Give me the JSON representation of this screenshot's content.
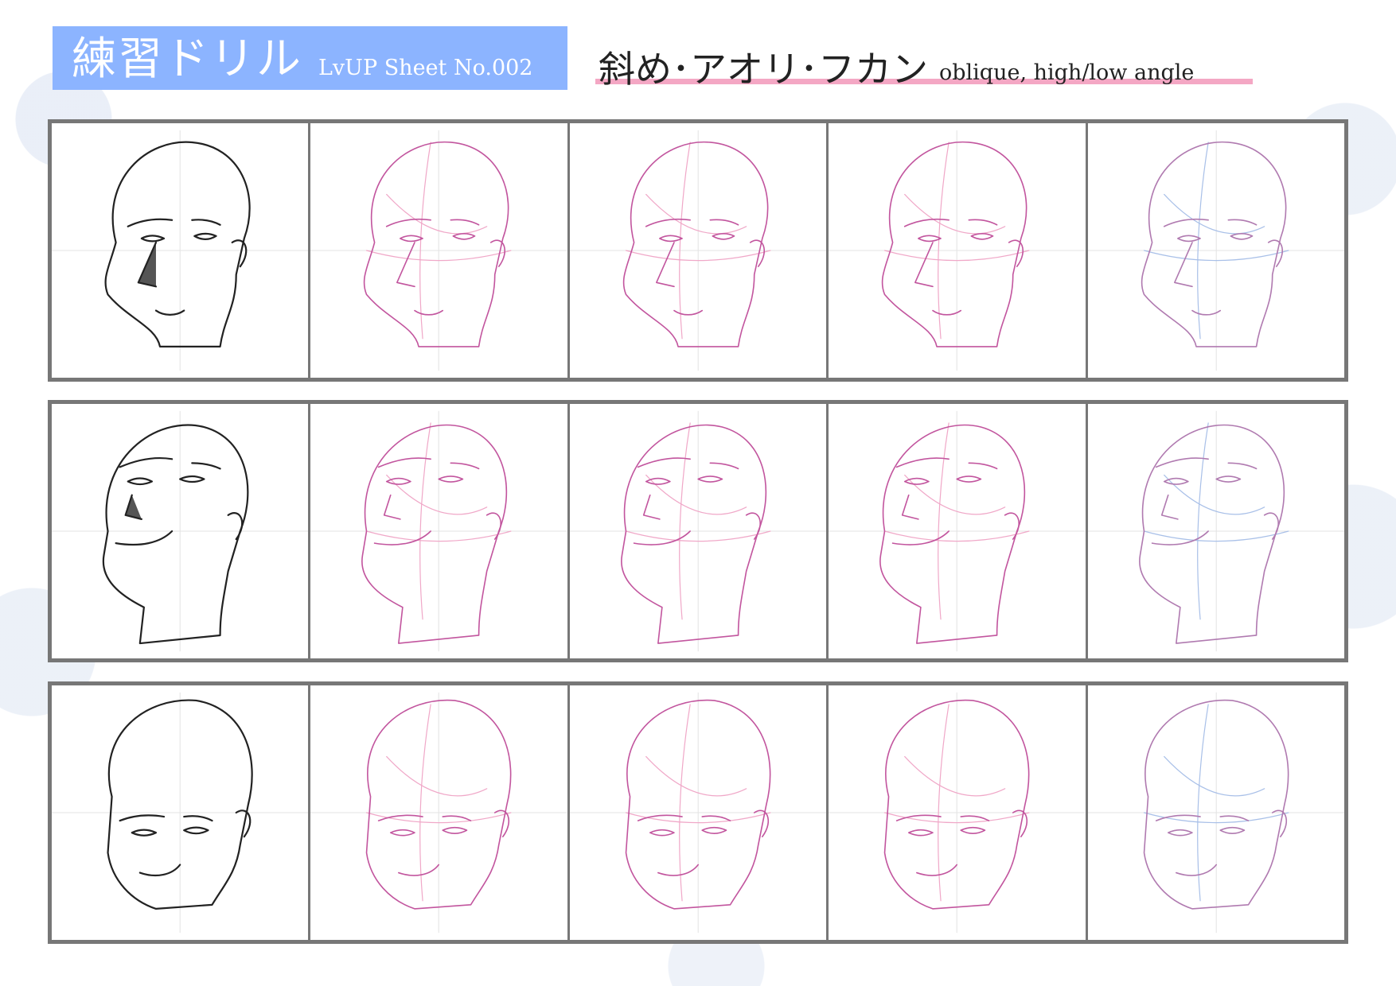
{
  "header": {
    "title": "練習ドリル",
    "sheet_label": "LvUP Sheet No.002",
    "subject_jp": "斜め･アオリ･フカン",
    "subject_en": "oblique, high/low angle"
  },
  "colors": {
    "title_bg": "#8cb4ff",
    "title_text": "#ffffff",
    "underline": "#f4a7c4",
    "frame": "#777777",
    "ink": "#222222",
    "guide_pink": "#c2559e",
    "guide_light": "#f0a8c8",
    "guide_blue": "#a9c0e8"
  },
  "rows": [
    {
      "name": "oblique",
      "cells": [
        "ink",
        "pink-guide",
        "pink-guide",
        "pink-guide",
        "faint-guide"
      ]
    },
    {
      "name": "low-angle",
      "cells": [
        "ink",
        "pink-guide",
        "pink-guide",
        "pink-guide",
        "faint-guide"
      ]
    },
    {
      "name": "high-angle",
      "cells": [
        "ink",
        "pink-guide",
        "pink-guide",
        "pink-guide",
        "faint-guide"
      ]
    }
  ]
}
